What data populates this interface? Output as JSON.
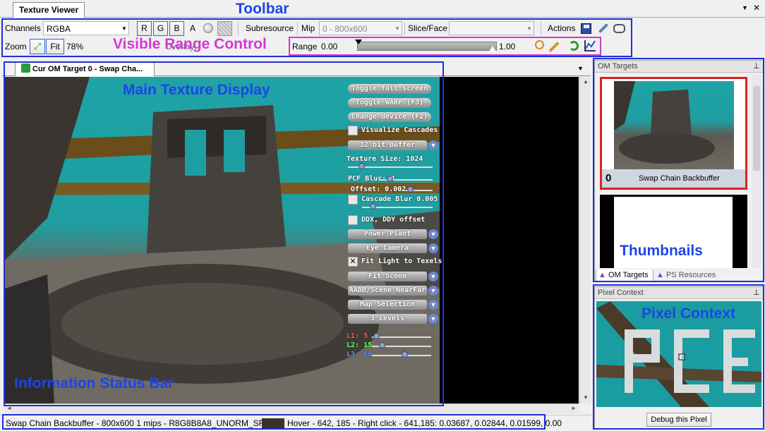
{
  "window": {
    "tab_title": "Texture Viewer",
    "menu_glyph": "▼",
    "close_glyph": "✕"
  },
  "toolbar": {
    "channels_label": "Channels",
    "channels_value": "RGBA",
    "channel_r": "R",
    "channel_g": "G",
    "channel_b": "B",
    "channel_a": "A",
    "subresource_label": "Subresource",
    "mip_label": "Mip",
    "mip_value": "0 - 800x600",
    "slice_label": "Slice/Face",
    "slice_value": "",
    "actions_label": "Actions",
    "zoom_label": "Zoom",
    "fit_label": "Fit",
    "zoom_value": "78%",
    "overlay_label": "Overlay",
    "range_label": "Range",
    "range_min": "0.00",
    "range_max": "1.00"
  },
  "document": {
    "tab_label": "Cur OM Target 0 - Swap Cha...",
    "dropdown_glyph": "▼"
  },
  "overlay": {
    "toggle_fullscreen": "Toggle full screen",
    "toggle_warp": "Toggle WARP (F3)",
    "change_device": "Change device (F2)",
    "visualize_cascades": "Visualize Cascades",
    "buffer_select": "32 bit Buffer",
    "texture_size": "Texture Size: 1024",
    "pcf_blur": "PCF Blur: 3",
    "offset": "Offset: 0.002",
    "cascade_blur": "Cascade Blur 0.005",
    "ddx_ddy": "DDX, DDY offset",
    "scene_select": "Power Plant",
    "camera_select": "Eye Camera",
    "fit_light": "Fit Light to Texels",
    "fit_select": "Fit Scene",
    "near_far_select": "AABB/Scene NearFar",
    "map_select": "Map Selection",
    "levels_select": "3 Levels",
    "l1": "L1: 5",
    "l2": "L2: 15",
    "l3": "L3: 60"
  },
  "right_panel": {
    "om_title": "OM Targets",
    "pin_glyph": "⊥",
    "thumb_index": "0",
    "thumb_caption": "Swap Chain Backbuffer",
    "tab_om": "OM Targets",
    "tab_ps": "PS Resources",
    "pixel_title": "Pixel Context",
    "debug_button": "Debug this Pixel"
  },
  "status": {
    "text": "Swap Chain Backbuffer - 800x600 1 mips - R8G8B8A8_UNORM_SRGB",
    "hover": "Hover - 642, 185 - Right click - 641,185: 0.03687, 0.02844, 0.01599, 0.00",
    "swatch_color": "#3a3129"
  },
  "annotations": {
    "toolbar": "Toolbar",
    "range_control": "Visible Range Control",
    "main_display": "Main Texture Display",
    "thumbnails": "Thumbnails",
    "pixel_context": "Pixel Context",
    "status_bar": "Information Status Bar"
  },
  "colors": {
    "annotation_blue": "#1f2fd9",
    "annotation_magenta": "#d238d2",
    "selection_red": "#e02020",
    "scene_teal": "#1e9ea0"
  }
}
